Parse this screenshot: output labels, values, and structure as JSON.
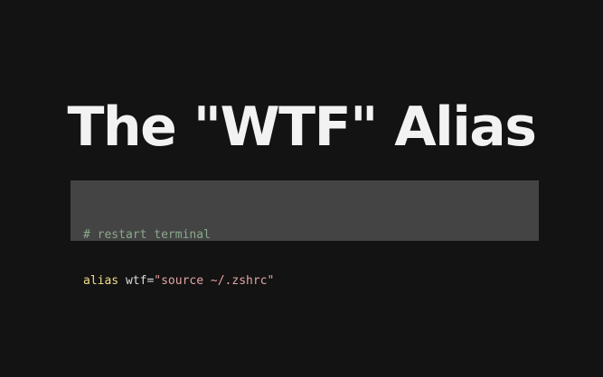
{
  "slide": {
    "title": "The \"WTF\" Alias"
  },
  "code": {
    "comment": "# restart terminal",
    "keyword": "alias",
    "assignment": " wtf=",
    "string": "\"source ~/.zshrc\""
  },
  "colors": {
    "background": "#131313",
    "title": "#f2f2f2",
    "code_background": "#444444",
    "comment": "#8aa88c",
    "keyword": "#f2dd8c",
    "plain": "#dcdcdc",
    "string": "#e6a3a3"
  }
}
